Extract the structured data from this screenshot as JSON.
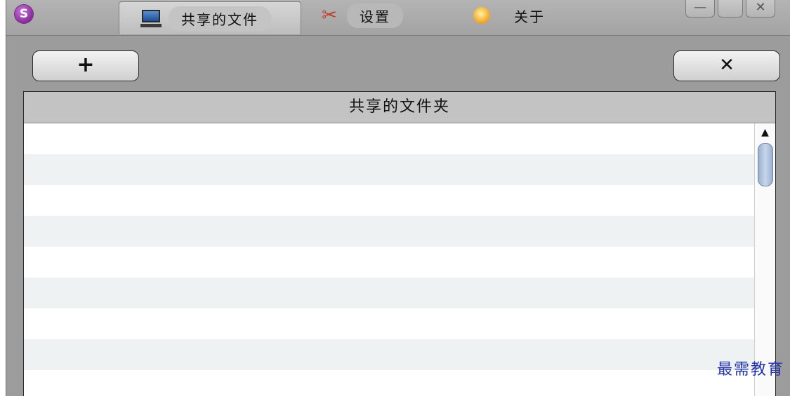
{
  "tabs": [
    {
      "label": "共享的文件",
      "icon": "monitor-icon",
      "active": true
    },
    {
      "label": "设置",
      "icon": "tools-icon",
      "active": false
    },
    {
      "label": "关于",
      "icon": "lightbulb-icon",
      "active": false
    }
  ],
  "window_controls": {
    "minimize": "—",
    "maximize": "",
    "close": "✕"
  },
  "toolbar": {
    "add_label": "+",
    "remove_label": "✕"
  },
  "list": {
    "header": "共享的文件夹",
    "rows": [
      "",
      "",
      "",
      "",
      "",
      "",
      "",
      "",
      ""
    ]
  },
  "scrollbar": {
    "up_arrow": "▲"
  },
  "watermark": "最需教育",
  "colors": {
    "accent": "#8a2a9c",
    "row_alt": "#eef2f2",
    "watermark": "#2436a8"
  }
}
